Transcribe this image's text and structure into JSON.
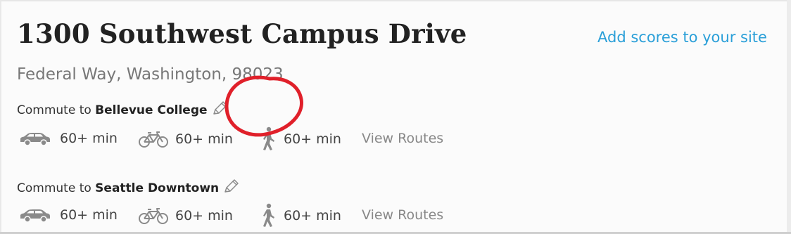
{
  "address": {
    "title": "1300 Southwest Campus Drive",
    "location": "Federal Way, Washington, 98023",
    "add_scores_link": "Add scores to your site"
  },
  "commutes": [
    {
      "prefix": "Commute to",
      "destination": "Bellevue College",
      "car_time": "60+ min",
      "bike_time": "60+ min",
      "walk_time": "60+ min",
      "view_routes": "View Routes"
    },
    {
      "prefix": "Commute to",
      "destination": "Seattle Downtown",
      "car_time": "60+ min",
      "bike_time": "60+ min",
      "walk_time": "60+ min",
      "view_routes": "View Routes"
    }
  ],
  "icons": {
    "edit": "pencil-icon",
    "car": "car-icon",
    "bike": "bicycle-icon",
    "walk": "walking-person-icon"
  },
  "colors": {
    "link": "#2a9fd8",
    "annotation": "#e0202a",
    "icon": "#8a8a8a"
  }
}
